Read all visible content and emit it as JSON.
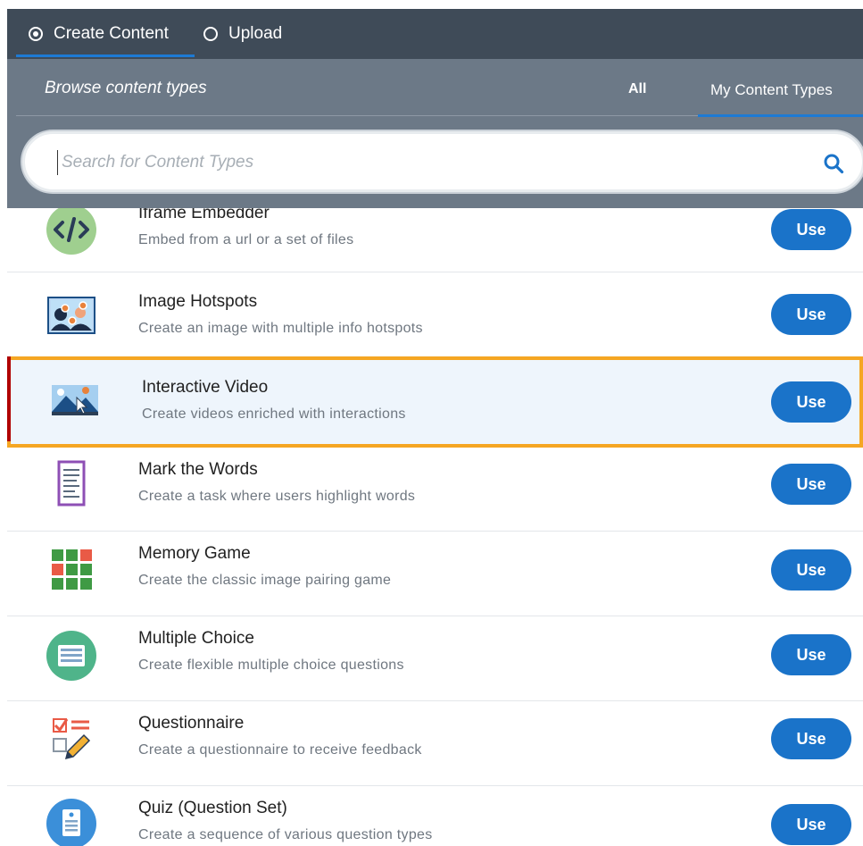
{
  "tabs": {
    "create": {
      "label": "Create Content",
      "selected": true
    },
    "upload": {
      "label": "Upload",
      "selected": false
    }
  },
  "browse": {
    "title": "Browse content types",
    "filters": {
      "all": "All",
      "mine": "My Content Types"
    },
    "active_filter": "My Content Types",
    "search": {
      "placeholder": "Search for Content Types",
      "value": ""
    }
  },
  "colors": {
    "topbar": "#3f4b58",
    "header": "#6c7987",
    "accent": "#1a73c9",
    "selection_border": "#f5a623"
  },
  "items": [
    {
      "title": "Iframe Embedder",
      "description": "Embed from a url or a set of files",
      "button": "Use",
      "icon": "iframe-embedder-icon"
    },
    {
      "title": "Image Hotspots",
      "description": "Create an image with multiple info hotspots",
      "button": "Use",
      "icon": "image-hotspots-icon"
    },
    {
      "title": "Interactive Video",
      "description": "Create videos enriched with interactions",
      "button": "Use",
      "icon": "interactive-video-icon",
      "selected": true
    },
    {
      "title": "Mark the Words",
      "description": "Create a task where users highlight words",
      "button": "Use",
      "icon": "mark-the-words-icon"
    },
    {
      "title": "Memory Game",
      "description": "Create the classic image pairing game",
      "button": "Use",
      "icon": "memory-game-icon"
    },
    {
      "title": "Multiple Choice",
      "description": "Create flexible multiple choice questions",
      "button": "Use",
      "icon": "multiple-choice-icon"
    },
    {
      "title": "Questionnaire",
      "description": "Create a questionnaire to receive feedback",
      "button": "Use",
      "icon": "questionnaire-icon"
    },
    {
      "title": "Quiz (Question Set)",
      "description": "Create a sequence of various question types",
      "button": "Use",
      "icon": "quiz-icon"
    }
  ]
}
